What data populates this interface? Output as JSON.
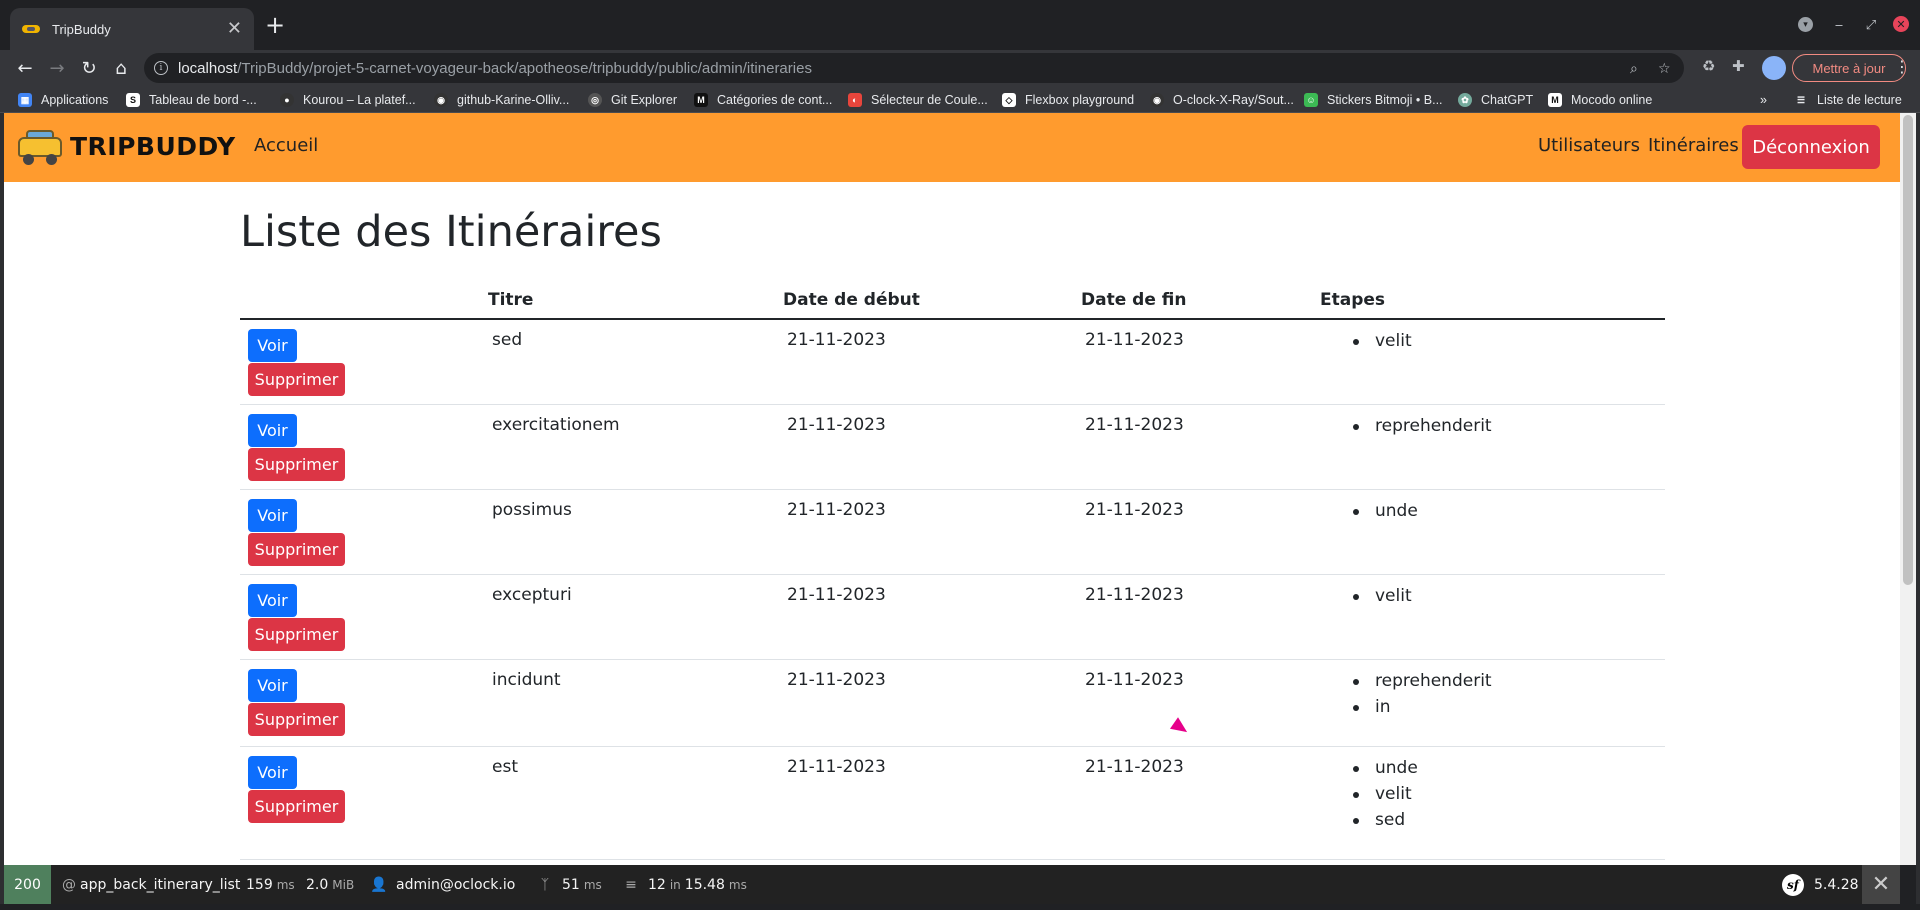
{
  "browser": {
    "tab_title": "TripBuddy",
    "tab_close": "✕",
    "new_tab": "+",
    "url_host": "localhost",
    "url_path": "/TripBuddy/projet-5-carnet-voyageur-back/apotheose/tripbuddy/public/admin/itineraries",
    "update_button": "Mettre à jour",
    "bookmarks": [
      {
        "label": "Applications",
        "icon_color": "#4285f4"
      },
      {
        "label": "Tableau de bord -...",
        "icon_color": "#ffffff"
      },
      {
        "label": "Kourou – La platef...",
        "icon_color": "#333333"
      },
      {
        "label": "github-Karine-Olliv...",
        "icon_color": "#333333"
      },
      {
        "label": "Git Explorer",
        "icon_color": "#555555"
      },
      {
        "label": "Catégories de cont...",
        "icon_color": "#111111"
      },
      {
        "label": "Sélecteur de Coule...",
        "icon_color": "#e8453c"
      },
      {
        "label": "Flexbox playground",
        "icon_color": "#ffffff"
      },
      {
        "label": "O-clock-X-Ray/Sout...",
        "icon_color": "#333333"
      },
      {
        "label": "Stickers Bitmoji • B...",
        "icon_color": "#3cba54"
      },
      {
        "label": "ChatGPT",
        "icon_color": "#74aa9c"
      },
      {
        "label": "Mocodo online",
        "icon_color": "#ffffff"
      }
    ],
    "bookmarks_more": "»",
    "reading_list": "Liste de lecture"
  },
  "site": {
    "brand": "TRIPBUDDY",
    "nav_home": "Accueil",
    "nav_users": "Utilisateurs",
    "nav_itineraries": "Itinéraires",
    "logout": "Déconnexion",
    "accent_color": "#ff9b2e"
  },
  "page": {
    "title": "Liste des Itinéraires",
    "columns": [
      "",
      "Titre",
      "Date de début",
      "Date de fin",
      "Etapes"
    ],
    "view_label": "Voir",
    "delete_label": "Supprimer",
    "rows": [
      {
        "titre": "sed",
        "debut": "21-11-2023",
        "fin": "21-11-2023",
        "etapes": [
          "velit"
        ]
      },
      {
        "titre": "exercitationem",
        "debut": "21-11-2023",
        "fin": "21-11-2023",
        "etapes": [
          "reprehenderit"
        ]
      },
      {
        "titre": "possimus",
        "debut": "21-11-2023",
        "fin": "21-11-2023",
        "etapes": [
          "unde"
        ]
      },
      {
        "titre": "excepturi",
        "debut": "21-11-2023",
        "fin": "21-11-2023",
        "etapes": [
          "velit"
        ]
      },
      {
        "titre": "incidunt",
        "debut": "21-11-2023",
        "fin": "21-11-2023",
        "etapes": [
          "reprehenderit",
          "in"
        ]
      },
      {
        "titre": "est",
        "debut": "21-11-2023",
        "fin": "21-11-2023",
        "etapes": [
          "unde",
          "velit",
          "sed"
        ]
      }
    ]
  },
  "debug_toolbar": {
    "status": "200",
    "route_prefix": "@",
    "route": "app_back_itinerary_list",
    "time": "159",
    "time_unit": "ms",
    "memory": "2.0",
    "memory_unit": "MiB",
    "user": "admin@oclock.io",
    "twig_time": "51",
    "twig_unit": "ms",
    "db_queries": "12",
    "db_in": "in",
    "db_time": "15.48",
    "db_unit": "ms",
    "version": "5.4.28"
  }
}
